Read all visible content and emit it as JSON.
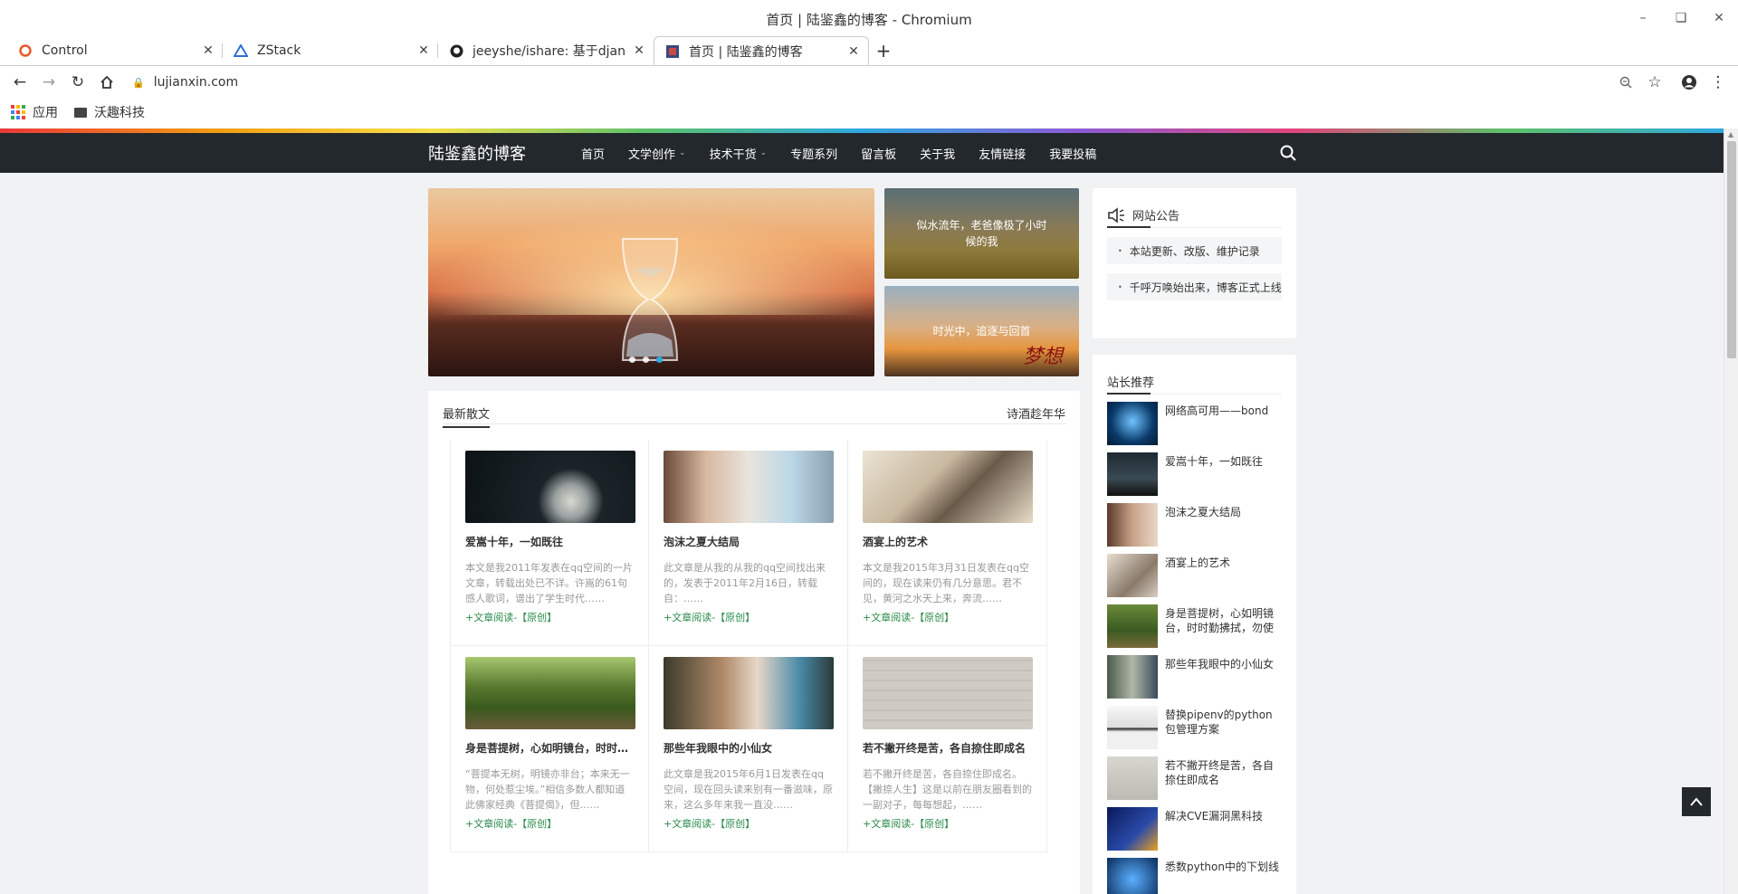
{
  "window": {
    "title": "首页 | 陆鉴鑫的博客 - Chromium"
  },
  "tabs": [
    {
      "label": "Control",
      "favicon": "control-favicon"
    },
    {
      "label": "ZStack",
      "favicon": "zstack-favicon"
    },
    {
      "label": "jeeyshe/ishare: 基于django",
      "favicon": "github-favicon"
    },
    {
      "label": "首页 | 陆鉴鑫的博客",
      "favicon": "blog-favicon",
      "active": true
    }
  ],
  "toolbar": {
    "url": "lujianxin.com"
  },
  "bookmarks": [
    {
      "label": "应用"
    },
    {
      "label": "沃趣科技"
    }
  ],
  "site": {
    "brand": "陆鉴鑫的博客",
    "nav": [
      {
        "label": "首页"
      },
      {
        "label": "文学创作",
        "dropdown": true
      },
      {
        "label": "技术干货",
        "dropdown": true
      },
      {
        "label": "专题系列"
      },
      {
        "label": "留言板"
      },
      {
        "label": "关于我"
      },
      {
        "label": "友情链接"
      },
      {
        "label": "我要投稿"
      }
    ]
  },
  "featured": [
    {
      "caption": "似水流年，老爸像极了小时候的我"
    },
    {
      "caption": "时光中，追逐与回首",
      "overlay": "梦想"
    }
  ],
  "carousel": {
    "slides": 3,
    "active": 3
  },
  "notice": {
    "title": "网站公告",
    "items": [
      "本站更新、改版、维护记录",
      "千呼万唤始出来，博客正式上线"
    ]
  },
  "recommend": {
    "title": "站长推荐",
    "items": [
      "网络高可用——bond",
      "爱嵩十年，一如既往",
      "泡沫之夏大结局",
      "酒宴上的艺术",
      "身是菩提树，心如明镜台，时时勤拂拭，勿使惹尘埃",
      "那些年我眼中的小仙女",
      "替换pipenv的python包管理方案",
      "若不撇开终是苦，各自捺住即成名",
      "解决CVE漏洞黑科技",
      "悉数python中的下划线"
    ]
  },
  "articles": {
    "section": "最新散文",
    "more": "诗酒趁年华",
    "items": [
      {
        "title": "爱嵩十年，一如既往",
        "desc": "本文是我2011年发表在qq空间的一片文章，转载出处已不详。许嵩的61句感人歌词，谱出了学生时代……",
        "more": "+文章阅读-【原创】"
      },
      {
        "title": "泡沫之夏大结局",
        "desc": "此文章是从我的从我的qq空间找出来的，发表于2011年2月16日，转载自：……",
        "more": "+文章阅读-【原创】"
      },
      {
        "title": "酒宴上的艺术",
        "desc": "本文是我2015年3月31日发表在qq空间的，现在读来仍有几分意思。君不见，黄河之水天上来，奔流……",
        "more": "+文章阅读-【原创】"
      },
      {
        "title": "身是菩提树，心如明镜台，时时勤拂拭",
        "desc": "“菩提本无树，明镜亦非台；本来无一物，何处惹尘埃。”相信多数人都知道此佛家经典《菩提偈》，但……",
        "more": "+文章阅读-【原创】"
      },
      {
        "title": "那些年我眼中的小仙女",
        "desc": "此文章是我2015年6月1日发表在qq空间，现在回头读来别有一番滋味，原来，这么多年来我一直没……",
        "more": "+文章阅读-【原创】"
      },
      {
        "title": "若不撇开终是苦，各自捺住即成名",
        "desc": "若不撇开终是苦，各自捺住即成名。【撇捺人生】这是以前在朋友圈看到的一副对子，每每想起，……",
        "more": "+文章阅读-【原创】"
      }
    ]
  },
  "colors": {
    "nav_bg": "#23282d",
    "page_bg": "#f1f2f3",
    "link_green": "#2a8a4a",
    "dot_active": "#2fa8e0"
  }
}
